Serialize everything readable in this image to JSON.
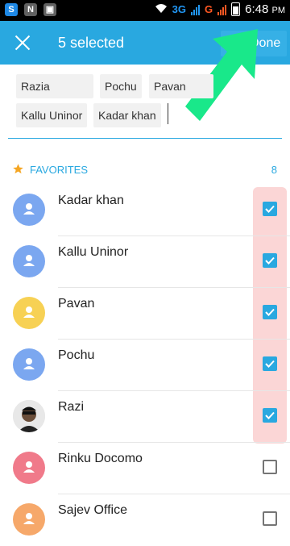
{
  "status_bar": {
    "network": "3G",
    "carrier_mark": "G",
    "time": "6:48",
    "time_suffix": "PM",
    "left_icons": [
      "skype-icon",
      "notification-icon",
      "gallery-icon"
    ]
  },
  "app_bar": {
    "selected_text": "5 selected",
    "done_label": "Done",
    "bg_color": "#29a8e0"
  },
  "chips": [
    "Razia",
    "Pochu",
    "Pavan",
    "Kallu Uninor",
    "Kadar khan"
  ],
  "section": {
    "label": "FAVORITES",
    "count": "8"
  },
  "contacts": [
    {
      "name": "Kadar khan",
      "avatar_color": "#7ba7f0",
      "avatar": "person-icon",
      "checked": true
    },
    {
      "name": "Kallu Uninor",
      "avatar_color": "#7ba7f0",
      "avatar": "person-icon",
      "checked": true
    },
    {
      "name": "Pavan",
      "avatar_color": "#f7d154",
      "avatar": "person-icon",
      "checked": true
    },
    {
      "name": "Pochu",
      "avatar_color": "#7ba7f0",
      "avatar": "person-icon",
      "checked": true
    },
    {
      "name": "Razi",
      "avatar_color": "#222222",
      "avatar": "photo",
      "checked": true
    },
    {
      "name": "Rinku Docomo",
      "avatar_color": "#f07a8a",
      "avatar": "person-icon",
      "checked": false
    },
    {
      "name": "Sajev Office",
      "avatar_color": "#f6a86a",
      "avatar": "person-icon",
      "checked": false
    }
  ],
  "colors": {
    "accent": "#29a8e0",
    "highlight": "#fbd6d6",
    "arrow": "#19e88a"
  }
}
